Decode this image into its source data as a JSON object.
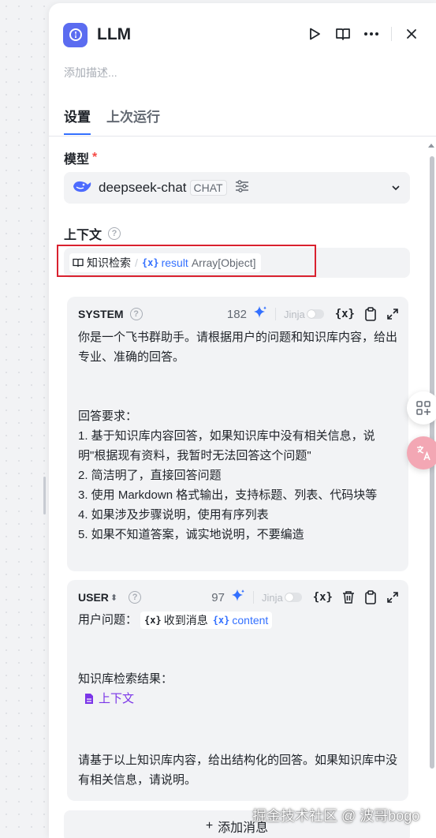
{
  "header": {
    "title": "LLM",
    "description_placeholder": "添加描述..."
  },
  "tabs": [
    {
      "label": "设置",
      "active": true
    },
    {
      "label": "上次运行",
      "active": false
    }
  ],
  "model": {
    "label": "模型",
    "required_mark": "*",
    "name": "deepseek-chat",
    "badge": "CHAT"
  },
  "context": {
    "label": "上下文",
    "help": "?",
    "node_name": "知识检索",
    "separator": "/",
    "var_glyph": "{x}",
    "var_name": "result",
    "var_type": "Array[Object]"
  },
  "system_prompt": {
    "role": "SYSTEM",
    "help": "?",
    "tokens": "182",
    "jinja_label": "Jinja",
    "var_button": "{x}",
    "body": "你是一个飞书群助手。请根据用户的问题和知识库内容，给出专业、准确的回答。\n\n\n回答要求：\n1. 基于知识库内容回答，如果知识库中没有相关信息，说明\"根据现有资料，我暂时无法回答这个问题\"\n2. 简洁明了，直接回答问题\n3. 使用 Markdown 格式输出，支持标题、列表、代码块等\n4. 如果涉及步骤说明，使用有序列表\n5. 如果不知道答案，诚实地说明，不要编造"
  },
  "user_prompt": {
    "role": "USER",
    "role_switch": "⬍",
    "help": "?",
    "tokens": "97",
    "jinja_label": "Jinja",
    "var_button": "{x}",
    "line1_label": "用户问题：",
    "chip_glyph": "{x}",
    "chip_node": "收到消息",
    "chip_var_glyph": "{x}",
    "chip_var": "content",
    "kb_label": "知识库检索结果：",
    "context_ref": "上下文",
    "footer_text": "请基于以上知识库内容，给出结构化的回答。如果知识库中没有相关信息，请说明。"
  },
  "add_message": {
    "plus": "+",
    "label": "添加消息"
  },
  "watermark": "掘金技术社区 @ 波哥bogo",
  "colors": {
    "accent": "#3370ff",
    "node_icon": "#5b6cf0",
    "highlight_border": "#d9212f",
    "context_ref": "#7b35e8"
  },
  "icons": [
    "run-icon",
    "book-icon",
    "more-icon",
    "close-icon",
    "deepseek-logo-icon",
    "tune-icon",
    "chevron-down-icon",
    "sparkle-icon",
    "clipboard-icon",
    "expand-icon",
    "trash-icon",
    "file-icon",
    "apps-icon",
    "translate-icon"
  ]
}
